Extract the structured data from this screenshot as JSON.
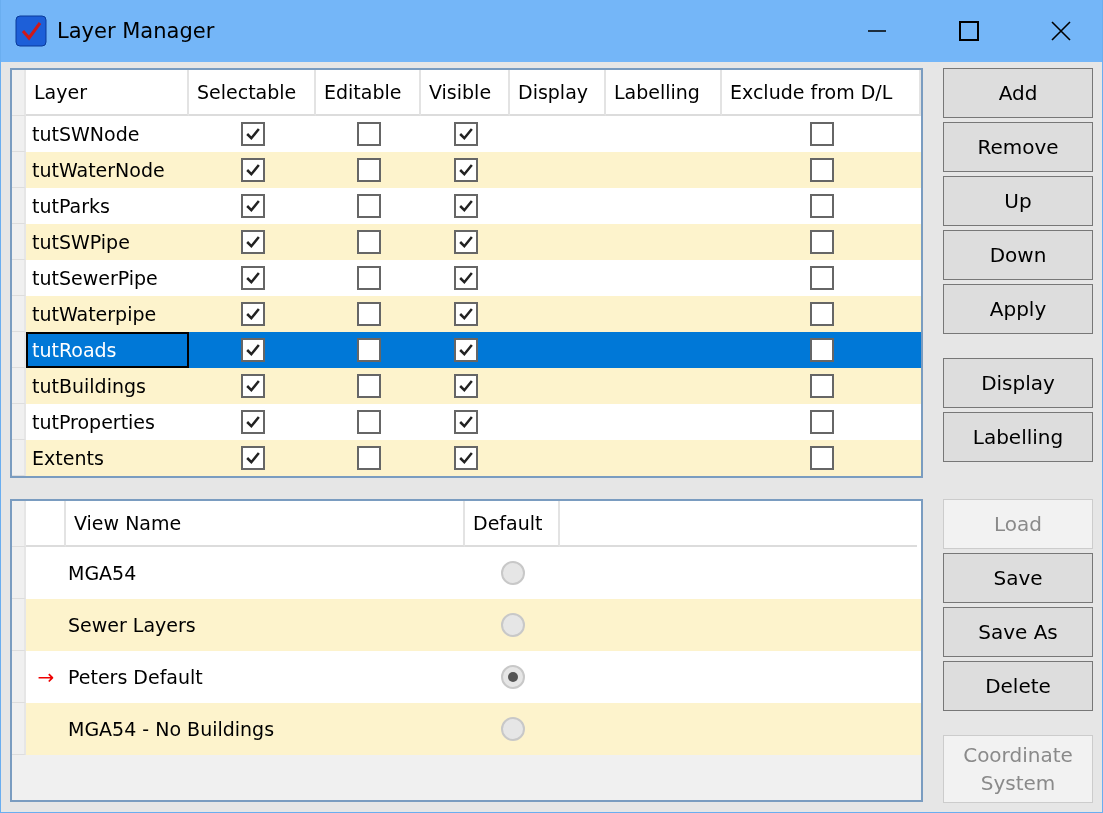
{
  "window": {
    "title": "Layer Manager"
  },
  "layers": {
    "columns": [
      "Layer",
      "Selectable",
      "Editable",
      "Visible",
      "Display",
      "Labelling",
      "Exclude from D/L"
    ],
    "rows": [
      {
        "name": "tutSWNode",
        "selectable": true,
        "editable": false,
        "visible": true,
        "exclude": false,
        "selected": false
      },
      {
        "name": "tutWaterNode",
        "selectable": true,
        "editable": false,
        "visible": true,
        "exclude": false,
        "selected": false
      },
      {
        "name": "tutParks",
        "selectable": true,
        "editable": false,
        "visible": true,
        "exclude": false,
        "selected": false
      },
      {
        "name": "tutSWPipe",
        "selectable": true,
        "editable": false,
        "visible": true,
        "exclude": false,
        "selected": false
      },
      {
        "name": "tutSewerPipe",
        "selectable": true,
        "editable": false,
        "visible": true,
        "exclude": false,
        "selected": false
      },
      {
        "name": "tutWaterpipe",
        "selectable": true,
        "editable": false,
        "visible": true,
        "exclude": false,
        "selected": false
      },
      {
        "name": "tutRoads",
        "selectable": true,
        "editable": false,
        "visible": true,
        "exclude": false,
        "selected": true
      },
      {
        "name": "tutBuildings",
        "selectable": true,
        "editable": false,
        "visible": true,
        "exclude": false,
        "selected": false
      },
      {
        "name": "tutProperties",
        "selectable": true,
        "editable": false,
        "visible": true,
        "exclude": false,
        "selected": false
      },
      {
        "name": "Extents",
        "selectable": true,
        "editable": false,
        "visible": true,
        "exclude": false,
        "selected": false
      }
    ]
  },
  "layer_buttons": [
    [
      {
        "label": "Add",
        "disabled": false
      },
      {
        "label": "Remove",
        "disabled": false
      },
      {
        "label": "Up",
        "disabled": false
      },
      {
        "label": "Down",
        "disabled": false
      },
      {
        "label": "Apply",
        "disabled": false
      }
    ],
    [
      {
        "label": "Display",
        "disabled": false
      },
      {
        "label": "Labelling",
        "disabled": false
      }
    ]
  ],
  "views": {
    "columns": [
      "View Name",
      "Default"
    ],
    "rows": [
      {
        "name": "MGA54",
        "default": false
      },
      {
        "name": "Sewer Layers",
        "default": false
      },
      {
        "marker": "→",
        "name": "Peters Default",
        "default": true
      },
      {
        "name": "MGA54 - No Buildings",
        "default": false
      }
    ]
  },
  "view_buttons": [
    [
      {
        "label": "Load",
        "disabled": true
      },
      {
        "label": "Save",
        "disabled": false
      },
      {
        "label": "Save As",
        "disabled": false
      },
      {
        "label": "Delete",
        "disabled": false
      }
    ],
    [
      {
        "label": "Coordinate System",
        "disabled": true
      }
    ]
  ]
}
